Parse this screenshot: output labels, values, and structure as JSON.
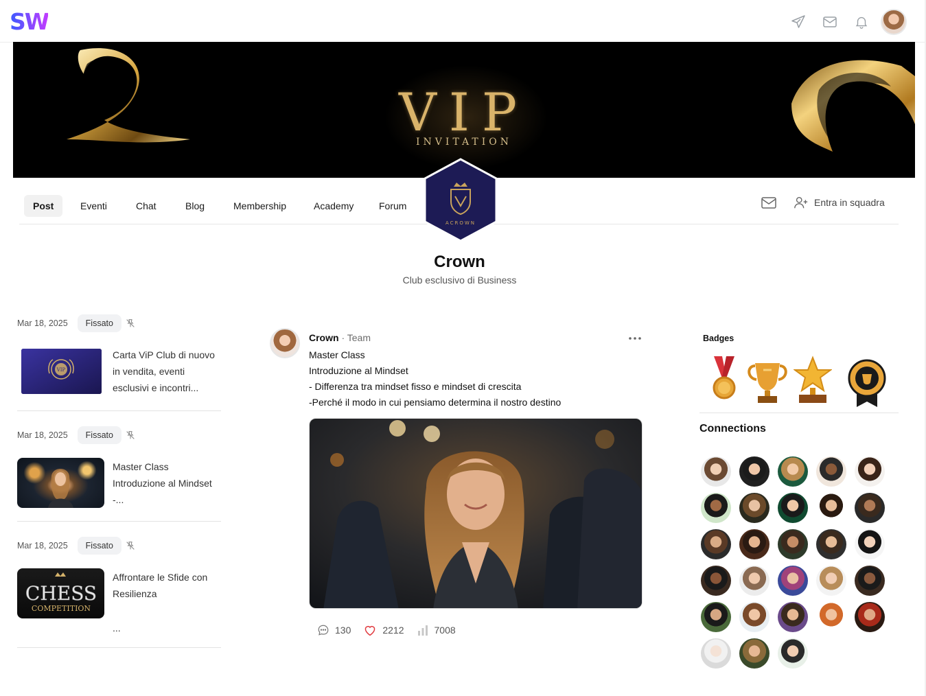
{
  "header": {
    "logo": "SW",
    "icons": [
      "send-icon",
      "mail-icon",
      "bell-icon"
    ]
  },
  "banner": {
    "title": "VIP",
    "subtitle": "INVITATION"
  },
  "nav": {
    "tabs": [
      {
        "label": "Post",
        "active": true
      },
      {
        "label": "Eventi",
        "active": false
      },
      {
        "label": "Chat",
        "active": false
      },
      {
        "label": "Blog",
        "active": false
      },
      {
        "label": "Membership",
        "active": false
      },
      {
        "label": "Academy",
        "active": false
      },
      {
        "label": "Forum",
        "active": false
      }
    ],
    "join_label": "Entra in squadra"
  },
  "group": {
    "emblem_text": "ACROWN",
    "name": "Crown",
    "subtitle": "Club esclusivo di Business"
  },
  "pinned": [
    {
      "date": "Mar 18, 2025",
      "badge": "Fissato",
      "text": "Carta ViP Club di nuovo in vendita, eventi esclusivi e incontri..."
    },
    {
      "date": "Mar 18, 2025",
      "badge": "Fissato",
      "text": "Master Class Introduzione al Mindset -..."
    },
    {
      "date": "Mar 18, 2025",
      "badge": "Fissato",
      "text": "Affrontare le Sfide con Resilienza",
      "extra": "...",
      "thumb_title": "CHESS",
      "thumb_sub": "COMPETITION"
    }
  ],
  "post": {
    "author": "Crown",
    "role": "Team",
    "lines": [
      "Master Class",
      "Introduzione al Mindset",
      "- Differenza tra mindset fisso e mindset di crescita",
      "-Perché il modo in cui pensiamo determina il nostro destino"
    ],
    "comments": "130",
    "likes": "2212",
    "views": "7008"
  },
  "sidebar": {
    "badges_title": "Badges",
    "badges": [
      "medal-badge",
      "trophy-badge",
      "star-trophy-badge",
      "first-place-badge"
    ],
    "connections_title": "Connections",
    "connections_count": 28
  },
  "colors": {
    "brand_gradient": [
      "#3b5bff",
      "#c23cff"
    ],
    "emblem_navy": "#1d1b55",
    "gold": "#d9b36a",
    "like_red": "#e0393e"
  }
}
